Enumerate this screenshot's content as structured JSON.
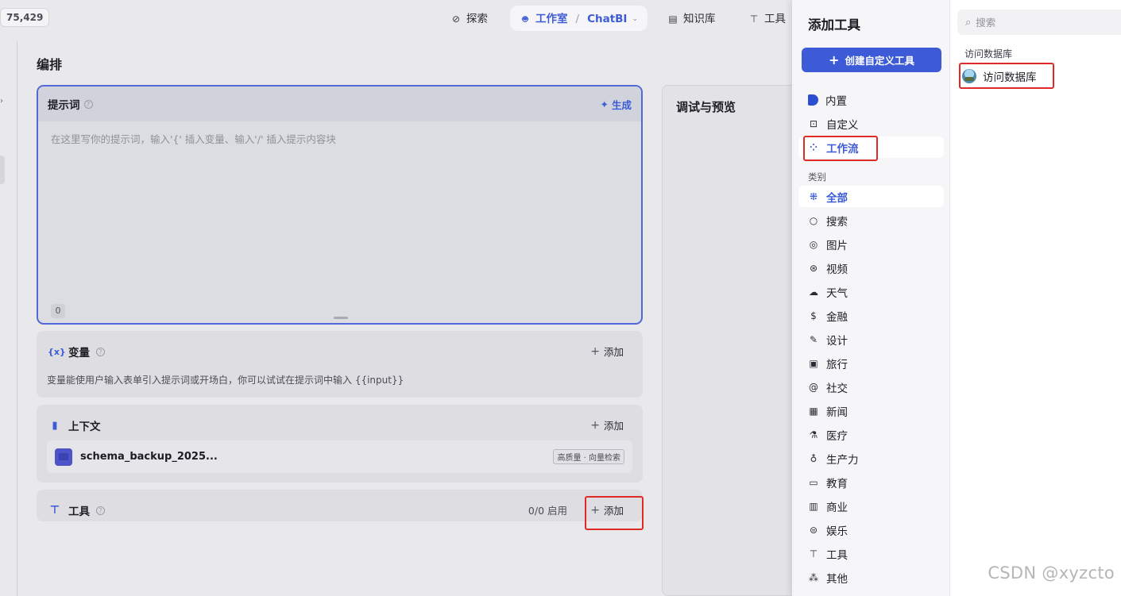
{
  "topbar": {
    "counter": "75,429",
    "nav": {
      "explore": "探索",
      "studio": "工作室",
      "studio_sep": "/",
      "app_name": "ChatBI",
      "knowledge": "知识库",
      "tools": "工具"
    }
  },
  "editor": {
    "page_title": "编排",
    "prompt": {
      "title": "提示词",
      "generate_label": "生成",
      "placeholder": "在这里写你的提示词，输入'{' 插入变量、输入'/' 插入提示内容块",
      "char_count": "0"
    },
    "variables": {
      "title": "变量",
      "icon_text": "{x}",
      "add_label": "添加",
      "description": "变量能使用户输入表单引入提示词或开场白，你可以试试在提示词中输入 {{input}}"
    },
    "context": {
      "title": "上下文",
      "add_label": "添加",
      "file_name": "schema_backup_2025...",
      "file_badge": "高质量 · 向量检索"
    },
    "tools": {
      "title": "工具",
      "status": "0/0 启用",
      "add_label": "添加"
    },
    "preview": {
      "title": "调试与预览"
    }
  },
  "modal": {
    "title": "添加工具",
    "create_button": "创建自定义工具",
    "sources": [
      {
        "label": "内置",
        "icon": "builtin-icon"
      },
      {
        "label": "自定义",
        "icon": "code-icon"
      },
      {
        "label": "工作流",
        "icon": "workflow-icon"
      }
    ],
    "category_section": "类别",
    "categories": [
      {
        "label": "全部",
        "icon": "grid-icon"
      },
      {
        "label": "搜索",
        "icon": "search-icon"
      },
      {
        "label": "图片",
        "icon": "image-icon"
      },
      {
        "label": "视频",
        "icon": "video-icon"
      },
      {
        "label": "天气",
        "icon": "cloud-icon"
      },
      {
        "label": "金融",
        "icon": "dollar-icon"
      },
      {
        "label": "设计",
        "icon": "design-icon"
      },
      {
        "label": "旅行",
        "icon": "travel-icon"
      },
      {
        "label": "社交",
        "icon": "at-icon"
      },
      {
        "label": "新闻",
        "icon": "news-icon"
      },
      {
        "label": "医疗",
        "icon": "medical-icon"
      },
      {
        "label": "生产力",
        "icon": "bulb-icon"
      },
      {
        "label": "教育",
        "icon": "education-icon"
      },
      {
        "label": "商业",
        "icon": "briefcase-icon"
      },
      {
        "label": "娱乐",
        "icon": "gamepad-icon"
      },
      {
        "label": "工具",
        "icon": "hammer-icon"
      },
      {
        "label": "其他",
        "icon": "other-icon"
      }
    ],
    "search_placeholder": "搜索",
    "group_label": "访问数据库",
    "tool_item": "访问数据库"
  },
  "watermark": "CSDN @xyzcto",
  "colors": {
    "accent": "#3d5bd6",
    "highlight": "#e02a2a"
  }
}
